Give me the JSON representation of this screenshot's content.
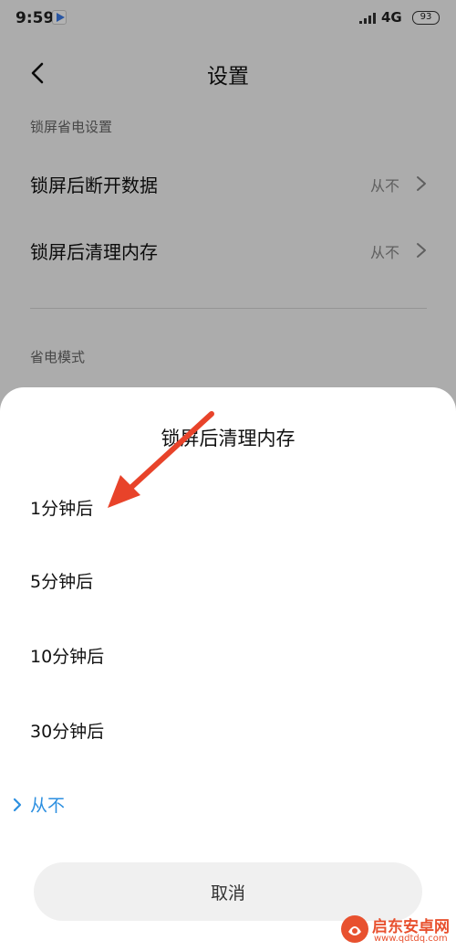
{
  "status_bar": {
    "time": "9:59",
    "network": "4G",
    "battery": "93"
  },
  "header": {
    "title": "设置"
  },
  "sections": [
    {
      "title": "锁屏省电设置",
      "rows": [
        {
          "label": "锁屏后断开数据",
          "value": "从不"
        },
        {
          "label": "锁屏后清理内存",
          "value": "从不"
        }
      ]
    },
    {
      "title": "省电模式"
    }
  ],
  "sheet": {
    "title": "锁屏后清理内存",
    "options": [
      {
        "label": "1分钟后",
        "selected": false
      },
      {
        "label": "5分钟后",
        "selected": false
      },
      {
        "label": "10分钟后",
        "selected": false
      },
      {
        "label": "30分钟后",
        "selected": false
      },
      {
        "label": "从不",
        "selected": true
      }
    ],
    "cancel_label": "取消"
  },
  "colors": {
    "accent": "#2c8fe0",
    "arrow": "#e8432a"
  },
  "icons": {
    "back": "back-icon",
    "row_chevron": "chevron-right-icon",
    "selected_marker": "check-chevron-icon"
  },
  "watermark": {
    "name": "启东安卓网",
    "url": "www.qdtdq.com"
  }
}
